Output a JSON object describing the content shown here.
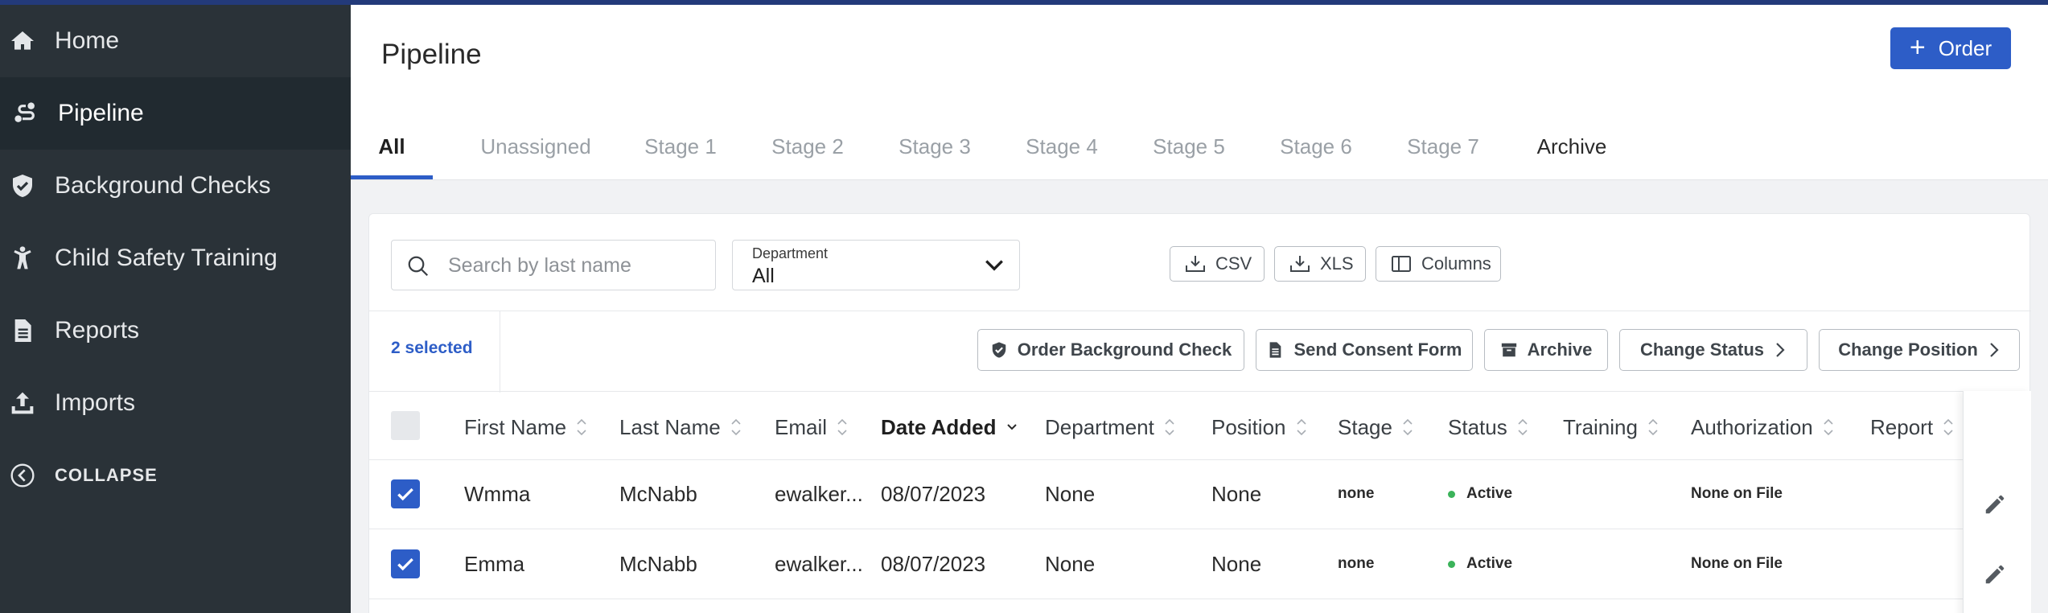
{
  "sidebar": {
    "items": [
      {
        "label": "Home",
        "icon": "home-icon"
      },
      {
        "label": "Pipeline",
        "icon": "pipeline-icon",
        "active": true
      },
      {
        "label": "Background Checks",
        "icon": "shield-check-icon"
      },
      {
        "label": "Child Safety Training",
        "icon": "child-icon"
      },
      {
        "label": "Reports",
        "icon": "document-icon"
      },
      {
        "label": "Imports",
        "icon": "upload-icon"
      },
      {
        "label": "COLLAPSE",
        "icon": "chevron-left-circle-icon"
      }
    ]
  },
  "header": {
    "title": "Pipeline",
    "order_button": "Order"
  },
  "tabs": [
    {
      "label": "All",
      "active": true
    },
    {
      "label": "Unassigned"
    },
    {
      "label": "Stage 1"
    },
    {
      "label": "Stage 2"
    },
    {
      "label": "Stage 3"
    },
    {
      "label": "Stage 4"
    },
    {
      "label": "Stage 5"
    },
    {
      "label": "Stage 6"
    },
    {
      "label": "Stage 7"
    },
    {
      "label": "Archive"
    }
  ],
  "filters": {
    "search_placeholder": "Search by last name",
    "department_label": "Department",
    "department_value": "All"
  },
  "exports": {
    "csv": "CSV",
    "xls": "XLS",
    "columns": "Columns"
  },
  "selection": {
    "count_label": "2 selected"
  },
  "actions": {
    "order_background_check": "Order Background Check",
    "send_consent_form": "Send Consent Form",
    "archive": "Archive",
    "change_status": "Change Status",
    "change_position": "Change Position"
  },
  "table": {
    "headers": [
      "First Name",
      "Last Name",
      "Email",
      "Date Added",
      "Department",
      "Position",
      "Stage",
      "Status",
      "Training",
      "Authorization",
      "Report"
    ],
    "sorted_column": "Date Added",
    "rows": [
      {
        "first": "Wmma",
        "last": "McNabb",
        "email": "ewalker...",
        "date": "08/07/2023",
        "department": "None",
        "position": "None",
        "stage": "none",
        "status": "Active",
        "training": "",
        "authorization": "None on File",
        "report": "",
        "checked": true
      },
      {
        "first": "Emma",
        "last": "McNabb",
        "email": "ewalker...",
        "date": "08/07/2023",
        "department": "None",
        "position": "None",
        "stage": "none",
        "status": "Active",
        "training": "",
        "authorization": "None on File",
        "report": "",
        "checked": true
      }
    ]
  },
  "colors": {
    "accent": "#2d5dc7",
    "sidebar_bg": "#2a3238",
    "sidebar_active_bg": "#212a30",
    "top_bar": "#233a7a",
    "status_active": "#3bb35a"
  }
}
